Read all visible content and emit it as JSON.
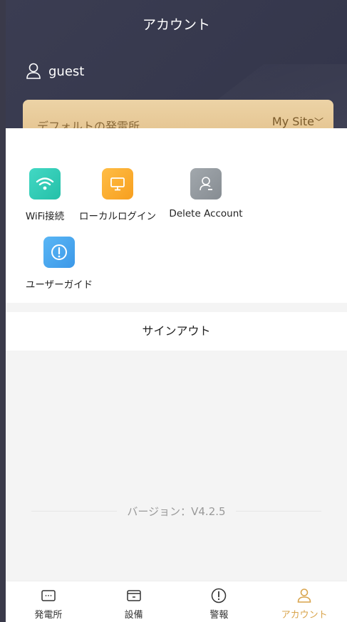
{
  "header": {
    "title": "アカウント",
    "username": "guest"
  },
  "site_bar": {
    "label": "デフォルトの発電所",
    "site": "My Site"
  },
  "menu": [
    {
      "label": "WiFi接続",
      "icon": "wifi-icon"
    },
    {
      "label": "ローカルログイン",
      "icon": "monitor-icon"
    },
    {
      "label": "Delete Account",
      "icon": "delete-account-icon"
    },
    {
      "label": "ユーザーガイド",
      "icon": "user-guide-icon"
    }
  ],
  "signout_label": "サインアウト",
  "version_text": "バージョン：V4.2.5",
  "nav": [
    {
      "label": "発電所",
      "icon": "plant-icon"
    },
    {
      "label": "設備",
      "icon": "device-icon"
    },
    {
      "label": "警報",
      "icon": "alarm-icon"
    },
    {
      "label": "アカウント",
      "icon": "account-icon",
      "active": true
    }
  ],
  "colors": {
    "header": "#3b3d52",
    "gold": "#e3c08a",
    "accent": "#d9a44c",
    "background": "#f4f4f4"
  }
}
